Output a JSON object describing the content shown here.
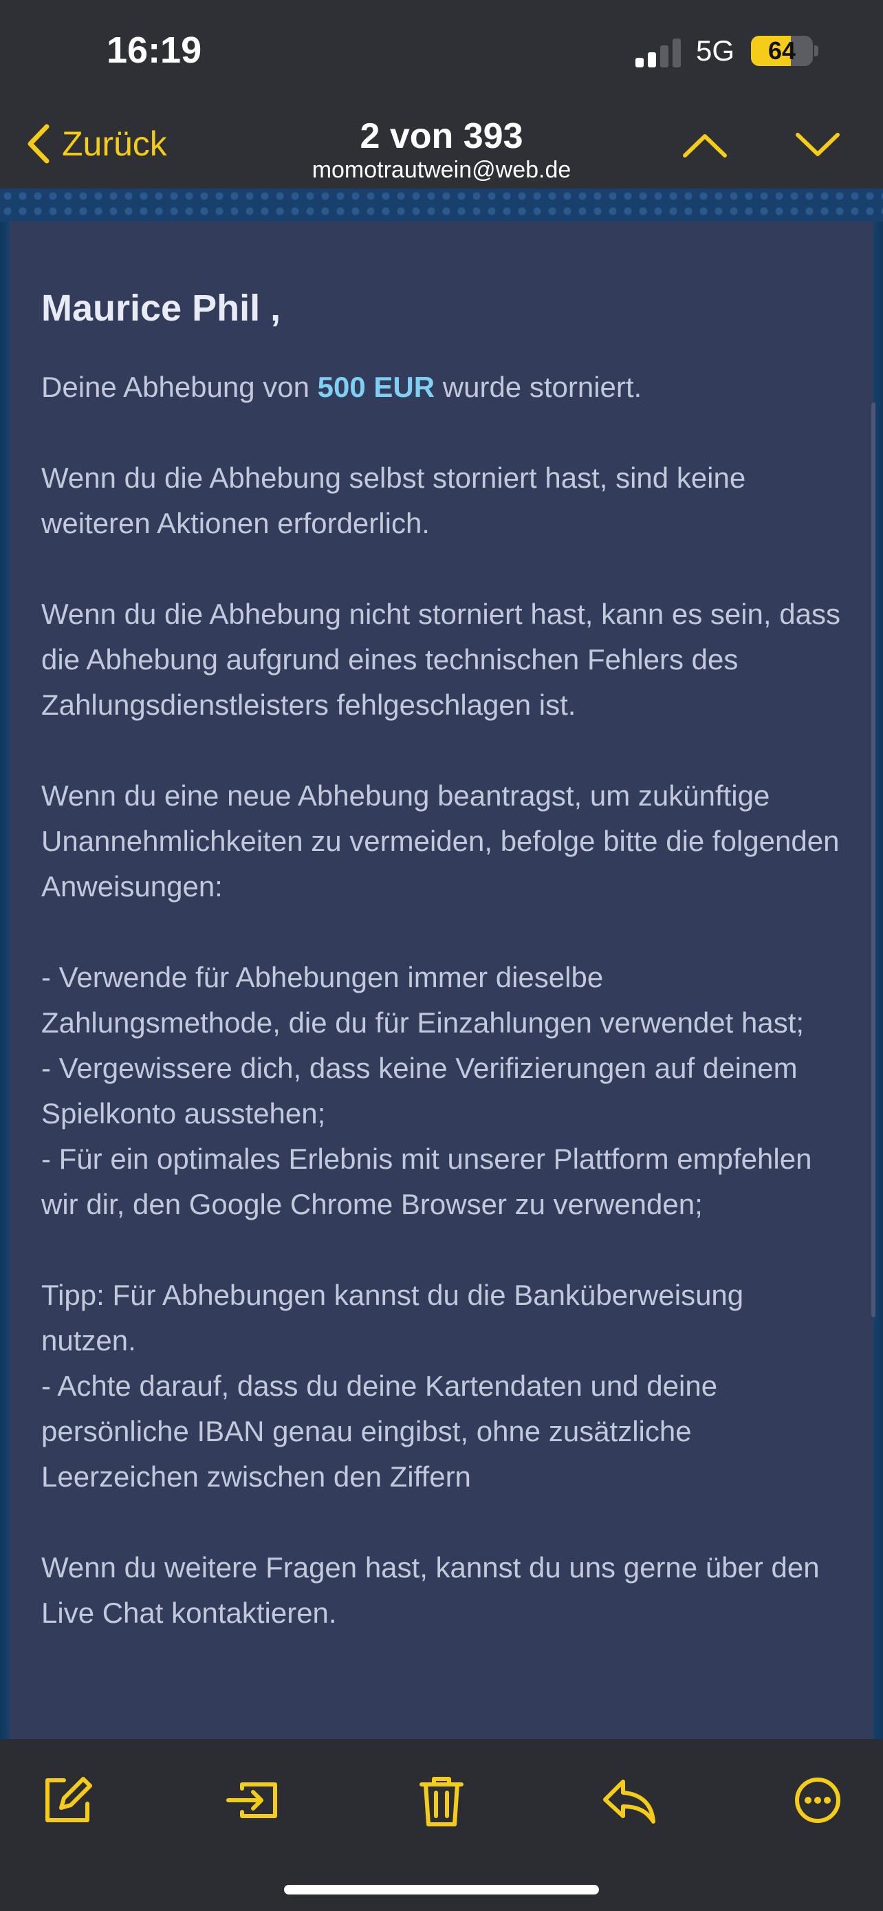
{
  "status_bar": {
    "time": "16:19",
    "network": "5G",
    "battery_level": "64",
    "battery_fraction": 0.64,
    "signal_bars_active": 2,
    "signal_bars_total": 4
  },
  "nav": {
    "back_label": "Zurück",
    "title": "2 von 393",
    "subtitle": "momotrautwein@web.de",
    "prev_icon": "chevron-up-icon",
    "next_icon": "chevron-down-icon"
  },
  "mail": {
    "greeting": "Maurice Phil ,",
    "p1_before": "Deine Abhebung von ",
    "p1_amount": "500 EUR",
    "p1_after": " wurde storniert.",
    "p2": "Wenn du die Abhebung selbst storniert hast, sind keine weiteren Aktionen erforderlich.",
    "p3": "Wenn du die Abhebung nicht storniert hast, kann es sein, dass die Abhebung aufgrund eines technischen Fehlers des Zahlungsdienstleisters fehlgeschlagen ist.",
    "p4": "Wenn du eine neue Abhebung beantragst, um zukünftige Unannehmlichkeiten zu vermeiden, befolge bitte die folgenden Anweisungen:",
    "list": [
      "- Verwende für Abhebungen immer dieselbe Zahlungsmethode, die du für Einzahlungen verwendet hast;",
      "- Vergewissere dich, dass keine Verifizierungen auf deinem Spielkonto ausstehen;",
      "- Für ein optimales Erlebnis mit unserer Plattform empfehlen wir dir, den Google Chrome Browser zu verwenden;"
    ],
    "tip": [
      "Tipp: Für Abhebungen kannst du die Banküberweisung nutzen.",
      "- Achte darauf, dass du deine Kartendaten und deine persönliche IBAN genau eingibst, ohne zusätzliche Leerzeichen zwischen den Ziffern"
    ],
    "p_last": "Wenn du weitere Fragen hast, kannst du uns gerne über den Live Chat kontaktieren."
  },
  "toolbar": {
    "icons": [
      "compose-icon",
      "move-icon",
      "trash-icon",
      "reply-icon",
      "more-icon"
    ]
  },
  "colors": {
    "accent": "#f5cc18",
    "highlight": "#7fd0f5",
    "card": "#333c5a",
    "bar": "#2e3036"
  }
}
